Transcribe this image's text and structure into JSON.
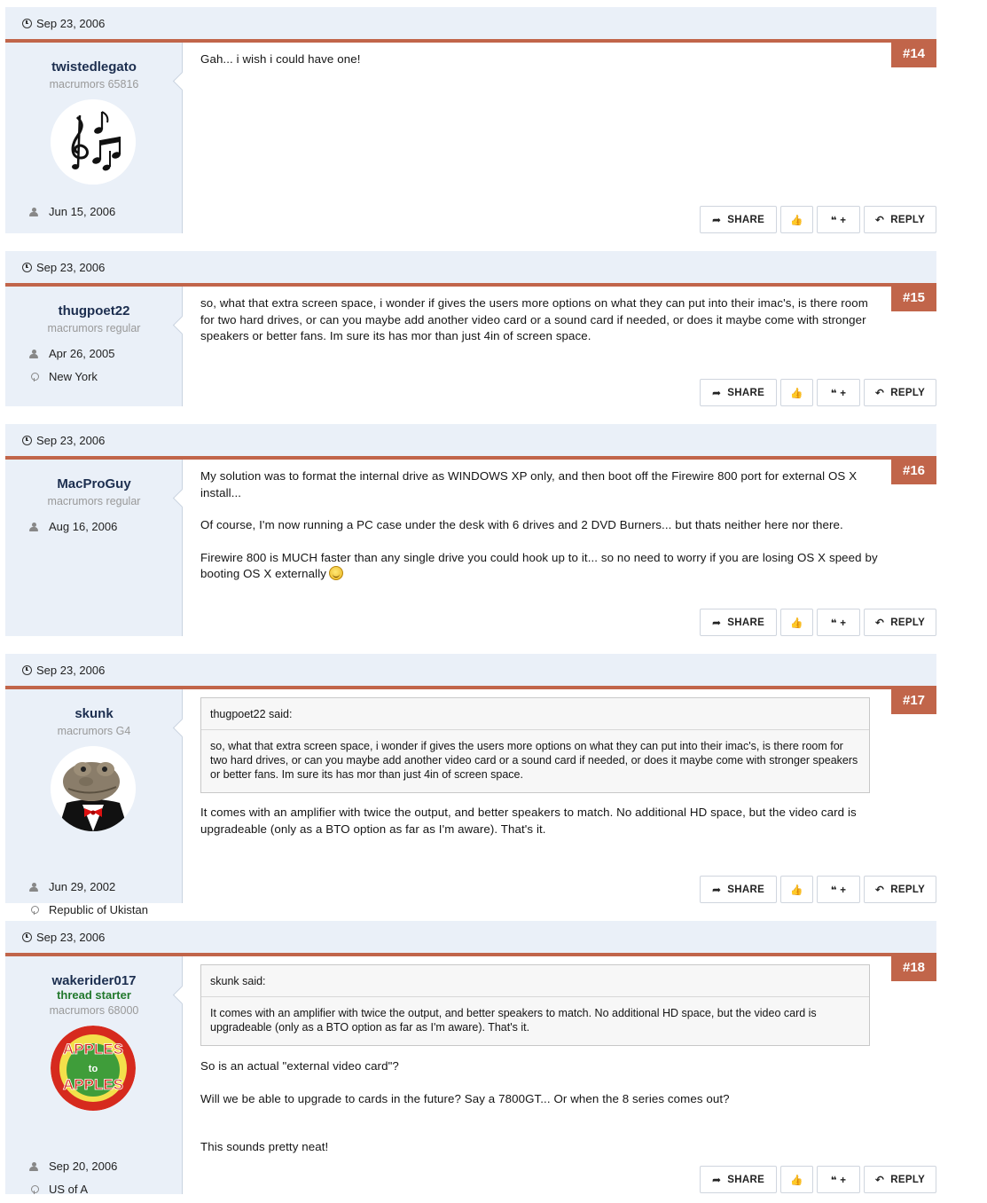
{
  "posts": [
    {
      "date": "Sep 23, 2006",
      "number": "#14",
      "username": "twistedlegato",
      "usertitle": "macrumors 65816",
      "avatar": "music-notes-avatar",
      "joined": "Jun 15, 2006",
      "location": "",
      "body": [
        "Gah... i wish i could have one!"
      ]
    },
    {
      "date": "Sep 23, 2006",
      "number": "#15",
      "username": "thugpoet22",
      "usertitle": "macrumors regular",
      "joined": "Apr 26, 2005",
      "location": "New York",
      "body": [
        "so, what that extra screen space, i wonder if gives the users more options on what they can put into their imac's, is there room for two hard drives, or can you maybe add another video card or a sound card if needed, or does it maybe come with stronger speakers or better fans. Im sure its has mor than just 4in of screen space."
      ]
    },
    {
      "date": "Sep 23, 2006",
      "number": "#16",
      "username": "MacProGuy",
      "usertitle": "macrumors regular",
      "joined": "Aug 16, 2006",
      "location": "",
      "body": [
        "My solution was to format the internal drive as WINDOWS XP only, and then boot off the Firewire 800 port for external OS X install...",
        "Of course, I'm now running a PC case under the desk with 6 drives and 2 DVD Burners... but thats neither here nor there.",
        "Firewire 800 is MUCH faster than any single drive you could hook up to it... so no need to worry if you are losing OS X speed by booting OS X externally"
      ]
    },
    {
      "date": "Sep 23, 2006",
      "number": "#17",
      "username": "skunk",
      "usertitle": "macrumors G4",
      "avatar": "frog-tuxedo-avatar",
      "joined": "Jun 29, 2002",
      "location": "Republic of Ukistan",
      "quote": {
        "author": "thugpoet22 said:",
        "text": "so, what that extra screen space, i wonder if gives the users more options on what they can put into their imac's, is there room for two hard drives, or can you maybe add another video card or a sound card if needed, or does it maybe come with stronger speakers or better fans. Im sure its has mor than just 4in of screen space."
      },
      "body": [
        "It comes with an amplifier with twice the output, and better speakers to match. No additional HD space, but the video card is upgradeable (only as a BTO option as far as I'm aware). That's it."
      ]
    },
    {
      "date": "Sep 23, 2006",
      "number": "#18",
      "username": "wakerider017",
      "thread_starter": "thread starter",
      "usertitle": "macrumors 68000",
      "avatar": "apples-to-apples-avatar",
      "avatar_text_1": "APPLES",
      "avatar_text_2": "to",
      "avatar_text_3": "APPLES",
      "joined": "Sep 20, 2006",
      "location": "US of A",
      "quote": {
        "author": "skunk said:",
        "text": "It comes with an amplifier with twice the output, and better speakers to match. No additional HD space, but the video card is upgradeable (only as a BTO option as far as I'm aware). That's it."
      },
      "body": [
        "So is an actual \"external video card\"?",
        "Will we be able to upgrade to cards in the future? Say a 7800GT... Or when the 8 series comes out?",
        "This sounds pretty neat!"
      ]
    }
  ],
  "actions": {
    "share": "SHARE",
    "reply": "REPLY",
    "like_icon": "thumbs-up-icon",
    "quote_icon": "quote-plus-icon"
  },
  "colors": {
    "accent": "#c1654a",
    "sidebar_bg": "#eaf0f8",
    "username": "#1c2e4f",
    "thread_starter": "#21782c"
  }
}
